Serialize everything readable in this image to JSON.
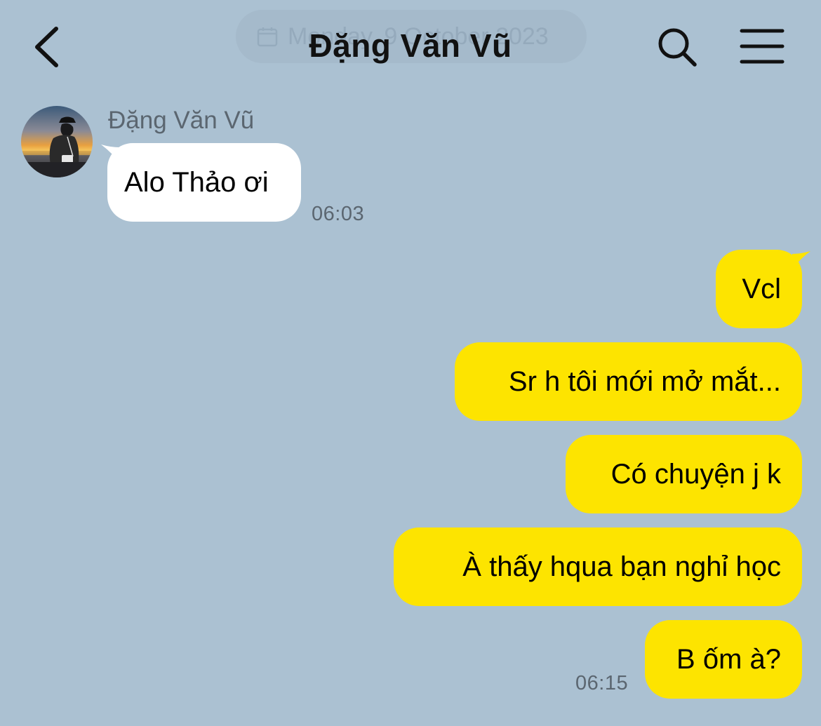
{
  "header": {
    "date_label": "Monday, 9 October 2023",
    "title": "Đặng Văn Vũ",
    "icons": {
      "back": "chevron-left-icon",
      "search": "search-icon",
      "menu": "hamburger-menu-icon",
      "date": "calendar-icon"
    }
  },
  "colors": {
    "background": "#abc1d2",
    "incoming_bubble": "#ffffff",
    "outgoing_bubble": "#fde400",
    "meta_text": "#5b6670"
  },
  "incoming": {
    "sender_name": "Đặng Văn Vũ",
    "messages": [
      {
        "text": "Alo Thảo ơi",
        "time": "06:03"
      }
    ]
  },
  "outgoing": {
    "messages": [
      {
        "text": "Vcl"
      },
      {
        "text": "Sr h tôi mới mở mắt..."
      },
      {
        "text": "Có chuyện j k"
      },
      {
        "text": "À thấy hqua bạn nghỉ học"
      },
      {
        "text": "B ốm à?",
        "time": "06:15"
      }
    ]
  }
}
